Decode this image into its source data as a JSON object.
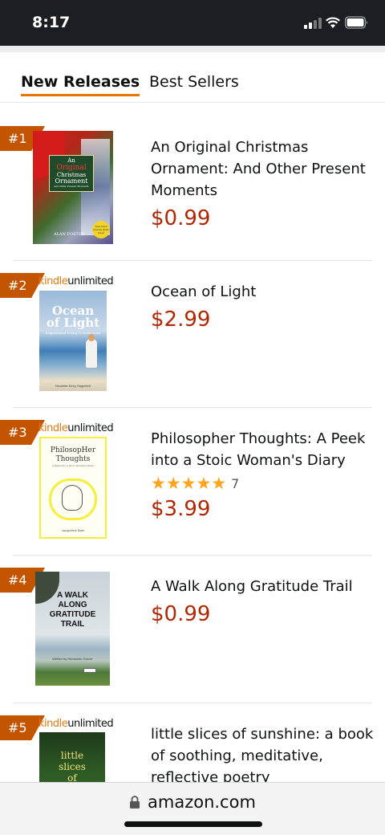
{
  "status": {
    "time": "8:17"
  },
  "tabs": {
    "new_releases": "New Releases",
    "best_sellers": "Best Sellers"
  },
  "books": [
    {
      "rank": "#1",
      "title": "An Original Christmas Ornament: And Other Present Moments",
      "price": "$0.99",
      "cover": {
        "line1": "An",
        "line2": "Original",
        "line3": "Christmas",
        "line4": "Ornament",
        "subtitle": "and Other Present Moments",
        "author": "ALAN FOSTER",
        "badge": "\"Feel Good\" Favorite Quick Read"
      }
    },
    {
      "rank": "#2",
      "kindle": "kindle",
      "unlimited": "unlimited",
      "title": "Ocean of Light",
      "price": "$2.99",
      "cover": {
        "line1": "Ocean",
        "line2": "of Light",
        "tagline": "Inspirational Poetry & Reflections",
        "author": "Nicolette Kirby Sagefeldt"
      }
    },
    {
      "rank": "#3",
      "kindle": "kindle",
      "unlimited": "unlimited",
      "title": "Philosopher Thoughts: A Peek into a Stoic Woman's Diary",
      "price": "$3.99",
      "rating": {
        "stars": 5,
        "count": "7"
      },
      "cover": {
        "line1": "PhilosopHer",
        "line2": "Thoughts",
        "subtitle": "A Peek into a Stoic Woman's Diary",
        "author": "Jacqueline Baer"
      }
    },
    {
      "rank": "#4",
      "title": "A Walk Along Gratitude Trail",
      "price": "$0.99",
      "cover": {
        "line1": "A WALK",
        "line2": "ALONG",
        "line3": "GRATITUDE",
        "line4": "TRAIL",
        "author": "Written by Himanshu Grover"
      }
    },
    {
      "rank": "#5",
      "kindle": "kindle",
      "unlimited": "unlimited",
      "title": "little slices of sunshine: a book of soothing, meditative, reflective poetry",
      "cover": {
        "line1": "little",
        "line2": "slices",
        "line3": "of"
      }
    }
  ],
  "url": "amazon.com"
}
